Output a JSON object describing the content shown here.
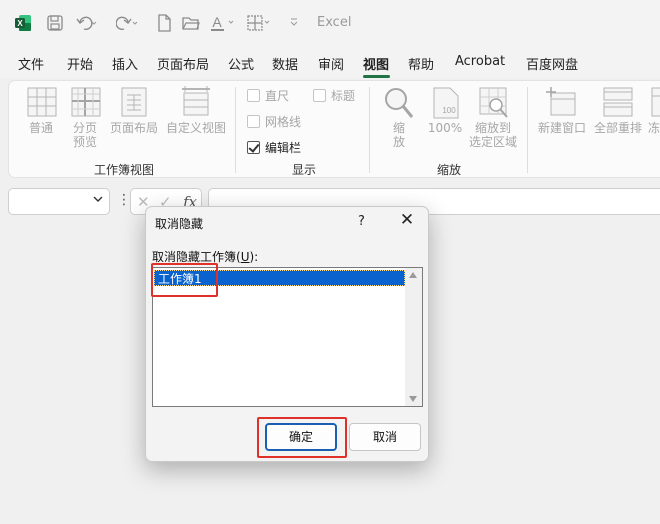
{
  "app": {
    "title": "Excel"
  },
  "quick_access": {
    "icons": [
      "excel-logo-icon",
      "save-icon",
      "undo-icon",
      "redo-icon",
      "new-file-icon",
      "open-folder-icon",
      "font-color-icon",
      "borders-icon",
      "customize-qat-icon"
    ]
  },
  "tabs": [
    "文件",
    "开始",
    "插入",
    "页面布局",
    "公式",
    "数据",
    "审阅",
    "视图",
    "帮助",
    "Acrobat",
    "百度网盘"
  ],
  "active_tab": "视图",
  "ribbon": {
    "workbook_views": {
      "label": "工作簿视图",
      "buttons": [
        {
          "line1": "普通",
          "line2": ""
        },
        {
          "line1": "分页",
          "line2": "预览"
        },
        {
          "line1": "页面布局",
          "line2": ""
        },
        {
          "line1": "自定义视图",
          "line2": ""
        }
      ]
    },
    "show": {
      "label": "显示",
      "ruler": "直尺",
      "title": "标题",
      "gridlines": "网格线",
      "formula_bar": "编辑栏",
      "formula_bar_checked": true
    },
    "zoom": {
      "label": "缩放",
      "zoom_line1": "缩",
      "zoom_line2": "放",
      "hundred": "100%",
      "to_selection_line1": "缩放到",
      "to_selection_line2": "选定区域"
    },
    "window": {
      "new_window": "新建窗口",
      "arrange_all": "全部重排",
      "freeze_partial": "冻"
    }
  },
  "formula_bar": {
    "fx": "fx",
    "cancel": "✕",
    "enter": "✓"
  },
  "dialog": {
    "title": "取消隐藏",
    "help": "?",
    "list_label_prefix": "取消隐藏工作簿(",
    "list_label_key": "U",
    "list_label_suffix": "):",
    "items": [
      "工作簿1"
    ],
    "selected_index": 0,
    "ok_label": "确定",
    "cancel_label": "取消"
  },
  "colors": {
    "accent": "#217346",
    "selection": "#0a62cf",
    "highlight": "#e0302a",
    "primary_border": "#1a5fb4"
  }
}
